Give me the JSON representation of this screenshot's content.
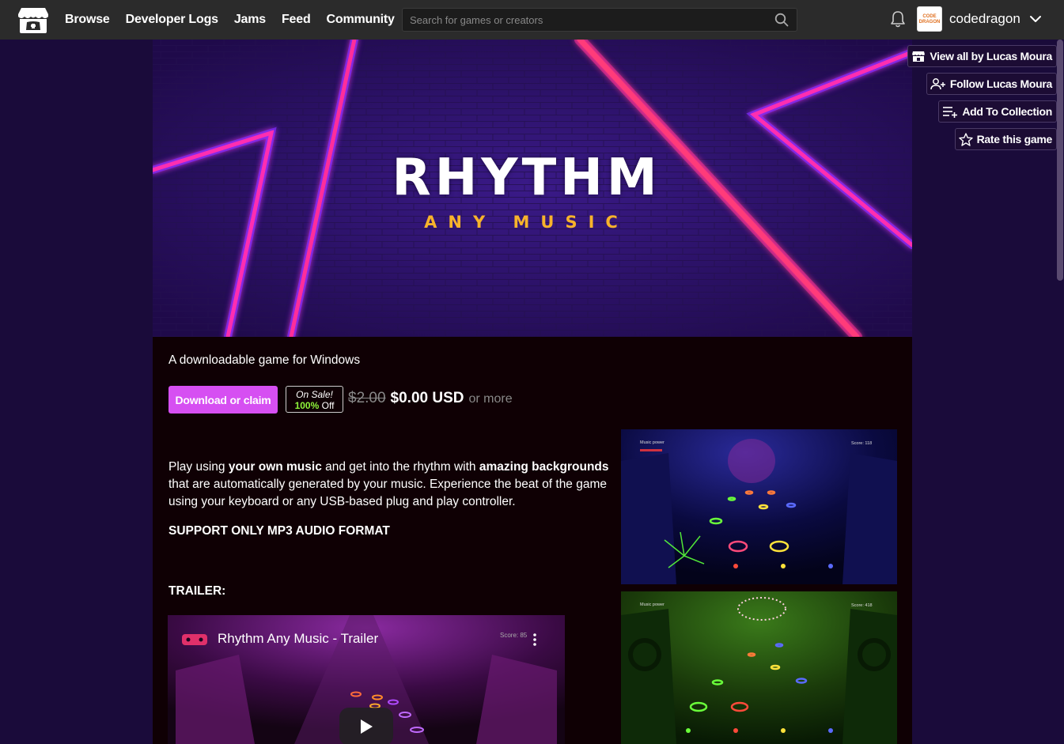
{
  "nav": {
    "links": [
      "Browse",
      "Developer Logs",
      "Jams",
      "Feed",
      "Community"
    ],
    "search_placeholder": "Search for games or creators",
    "username": "codedragon",
    "avatar_text": "CODE\nDRAGON"
  },
  "side_actions": {
    "view_all": "View all by Lucas Moura",
    "follow": "Follow Lucas Moura",
    "add_collection": "Add To Collection",
    "rate": "Rate this game"
  },
  "banner": {
    "title": "RHYTHM",
    "subtitle": "ANY MUSIC"
  },
  "game": {
    "tagline": "A downloadable game for Windows",
    "download_label": "Download or claim",
    "sale_label": "On Sale!",
    "sale_percent": "100%",
    "sale_off": "Off",
    "old_price": "$2.00",
    "new_price": "$0.00 USD",
    "or_more": "or more",
    "desc_1": "Play using ",
    "desc_b1": "your own music",
    "desc_2": " and get into the rhythm with ",
    "desc_b2": "amazing backgrounds",
    "desc_3": " that are automatically generated by your music. Experience the beat of the game using your keyboard or any USB-based plug and play controller.",
    "support": "SUPPORT ONLY MP3 AUDIO FORMAT",
    "trailer_heading": "TRAILER:",
    "video_title": "Rhythm Any Music - Trailer",
    "video_score": "Score:   85"
  },
  "screenshots": [
    {
      "label_left": "Music power",
      "label_right": "Score:   118"
    },
    {
      "label_left": "Music power",
      "label_right": "Score:   418"
    }
  ],
  "colors": {
    "page_bg": "#1a0b3a",
    "nav_bg": "#2b2b2b",
    "accent": "#d64ff2",
    "neon_pink": "#ff2f9a",
    "gold": "#f7b32b"
  }
}
